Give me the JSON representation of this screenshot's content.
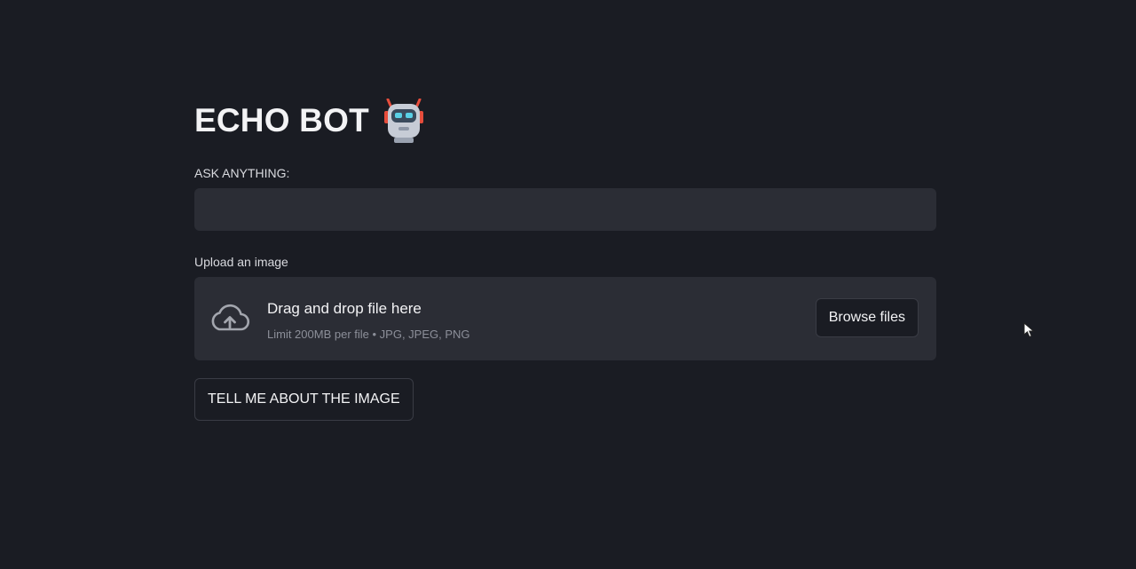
{
  "header": {
    "title": "ECHO BOT",
    "title_icon": "robot-icon"
  },
  "question": {
    "label": "ASK ANYTHING:",
    "value": ""
  },
  "uploader": {
    "label": "Upload an image",
    "icon": "cloud-upload-icon",
    "drop_text": "Drag and drop file here",
    "limit_text": "Limit 200MB per file • JPG, JPEG, PNG",
    "browse_label": "Browse files"
  },
  "actions": {
    "describe_label": "TELL ME ABOUT THE IMAGE"
  },
  "colors": {
    "background": "#1a1c23",
    "input_background": "#2b2d35",
    "text": "#f3f3f5",
    "muted_text": "#8c8f99"
  }
}
